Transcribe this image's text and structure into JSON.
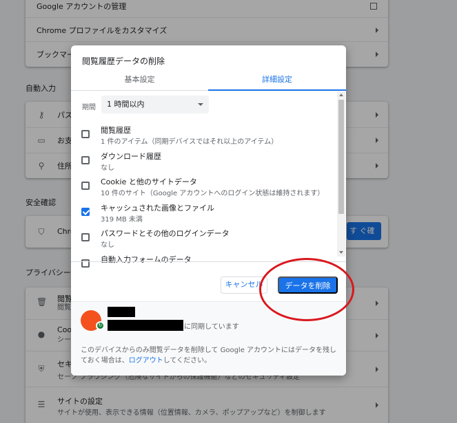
{
  "background": {
    "rows_top": [
      {
        "label": "Google アカウントの管理"
      },
      {
        "label": "Chrome プロファイルをカスタマイズ"
      },
      {
        "label": "ブックマー"
      }
    ],
    "sections": [
      {
        "title": "自動入力",
        "items": [
          {
            "label": "パス",
            "icon": "key-icon"
          },
          {
            "label": "お支",
            "icon": "credit-card-icon"
          },
          {
            "label": "住所",
            "icon": "location-pin-icon"
          }
        ]
      },
      {
        "title": "安全確認",
        "items": [
          {
            "label": "Chrom",
            "icon": "shield-icon",
            "button": "す ぐ確認"
          }
        ]
      },
      {
        "title": "プライバシー",
        "items": [
          {
            "label": "閲覧",
            "sub": "閲覧",
            "icon": "trash-icon"
          },
          {
            "label": "Cook",
            "sub": "シー",
            "icon": "cookie-icon"
          },
          {
            "label": "セキ",
            "sub": "セーフ ブラウジング（危険なサイトからの保護機能）などのセキュリティ設定",
            "icon": "shield-half-icon"
          },
          {
            "label": "サイトの設定",
            "sub": "サイトが使用、表示できる情報（位置情報、カメラ、ポップアップなど）を制御します",
            "icon": "sliders-icon"
          }
        ]
      }
    ]
  },
  "dialog": {
    "title": "閲覧履歴データの削除",
    "tabs": [
      {
        "label": "基本設定"
      },
      {
        "label": "詳細設定"
      }
    ],
    "period_label": "期間",
    "period_value": "1 時間以内",
    "items": [
      {
        "title": "閲覧履歴",
        "sub": "1 件のアイテム（同期デバイスではそれ以上のアイテム）",
        "checked": false
      },
      {
        "title": "ダウンロード履歴",
        "sub": "なし",
        "checked": false
      },
      {
        "title": "Cookie と他のサイトデータ",
        "sub": "10 件のサイト（Google アカウントへのログイン状態は維持されます）",
        "checked": false
      },
      {
        "title": "キャッシュされた画像とファイル",
        "sub": "319 MB 未満",
        "checked": true
      },
      {
        "title": "パスワードとその他のログインデータ",
        "sub": "なし",
        "checked": false
      },
      {
        "title": "自動入力フォームのデータ",
        "sub": "",
        "checked": false
      }
    ],
    "cancel_label": "キャンセル",
    "delete_label": "データを削除",
    "sync_text": "に同期しています",
    "note_before": "このデバイスからのみ閲覧データを削除して Google アカウントにはデータを残しておく場合は、",
    "note_link": "ログアウト",
    "note_after": "してください。"
  },
  "colors": {
    "accent": "#1a73e8",
    "annotation": "#d9181e",
    "avatar": "#f4511e"
  }
}
